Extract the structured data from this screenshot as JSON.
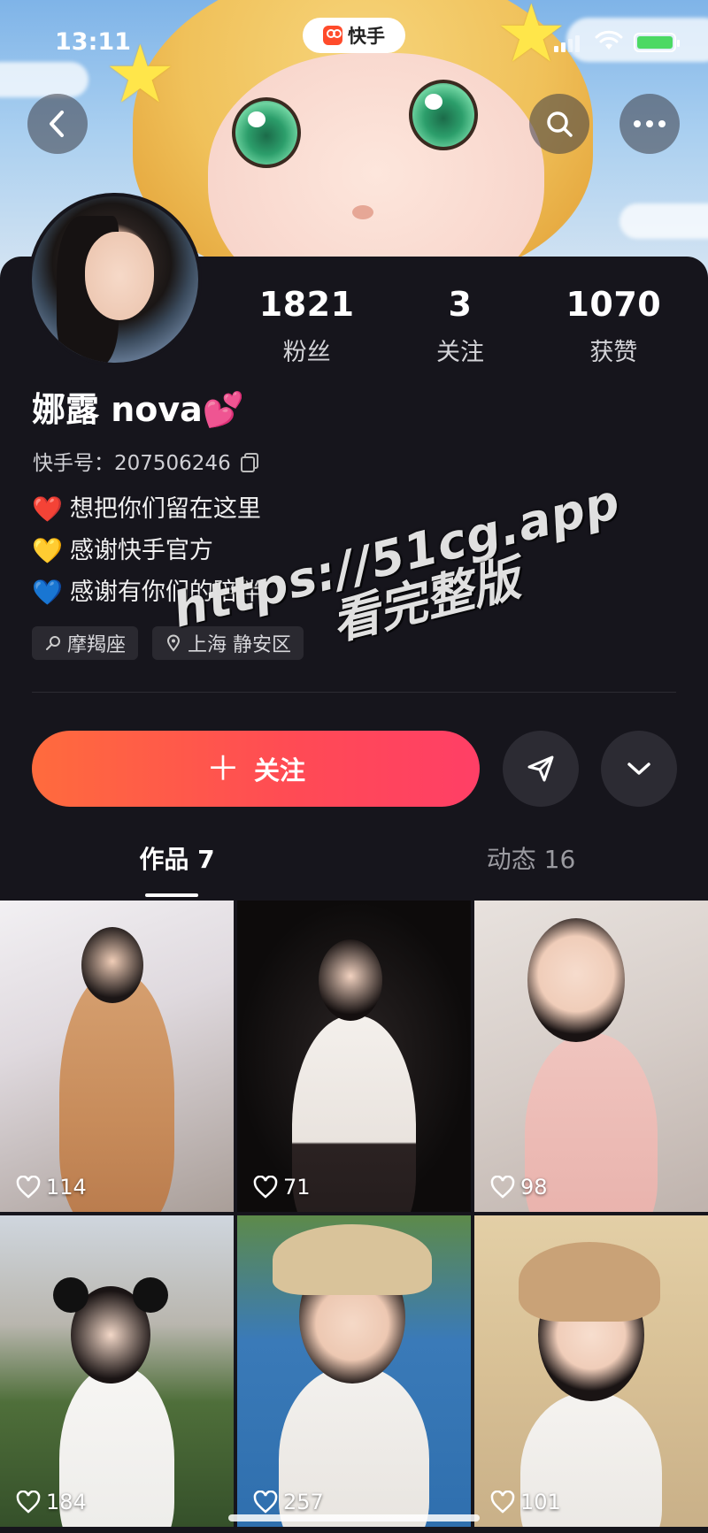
{
  "status_bar": {
    "time": "13:11",
    "app_name": "快手"
  },
  "profile": {
    "name": "娜露 nova",
    "name_emoji": "💕",
    "kuaishou_id_label": "快手号：",
    "kuaishou_id": "207506246",
    "stats": [
      {
        "value": "1821",
        "label": "粉丝"
      },
      {
        "value": "3",
        "label": "关注"
      },
      {
        "value": "1070",
        "label": "获赞"
      }
    ],
    "bio": [
      {
        "emoji": "❤️",
        "text": "想把你们留在这里"
      },
      {
        "emoji": "💛",
        "text": "感谢快手官方"
      },
      {
        "emoji": "💙",
        "text": "感谢有你们的陪伴"
      }
    ],
    "tags": [
      {
        "icon": "zodiac-icon",
        "text": "摩羯座"
      },
      {
        "icon": "location-pin-icon",
        "text": "上海 静安区"
      }
    ]
  },
  "actions": {
    "follow_label": "关注"
  },
  "tabs": [
    {
      "label": "作品 7",
      "active": true
    },
    {
      "label": "动态 16",
      "active": false
    }
  ],
  "videos": [
    {
      "likes": "114"
    },
    {
      "likes": "71"
    },
    {
      "likes": "98"
    },
    {
      "likes": "184"
    },
    {
      "likes": "257"
    },
    {
      "likes": "101"
    }
  ],
  "watermark": {
    "line1": "https://51cg.app",
    "line2": "看完整版"
  },
  "colors": {
    "follow_start": "#ff6b3d",
    "follow_end": "#ff3f66",
    "background": "#16151c"
  }
}
